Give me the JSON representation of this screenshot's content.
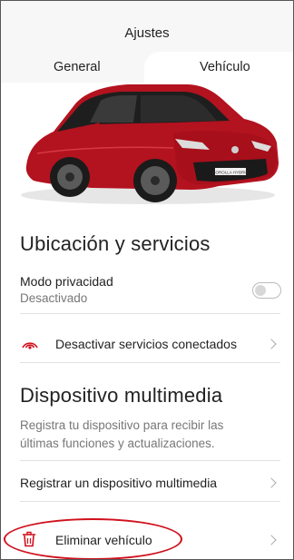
{
  "header": {
    "title": "Ajustes"
  },
  "tabs": [
    {
      "label": "General",
      "active": false
    },
    {
      "label": "Vehículo",
      "active": true
    }
  ],
  "vehicle": {
    "plate_text": "COROLLA HYBRID",
    "body_color": "#b3121f"
  },
  "location_section": {
    "title": "Ubicación y servicios",
    "privacy": {
      "label": "Modo privacidad",
      "status": "Desactivado",
      "enabled": false
    },
    "disconnect": {
      "label": "Desactivar servicios conectados",
      "icon": "signal-waves-icon"
    }
  },
  "multimedia_section": {
    "title": "Dispositivo multimedia",
    "description": "Registra tu dispositivo para recibir las últimas funciones y actualizaciones.",
    "register": {
      "label": "Registrar un dispositivo multimedia"
    }
  },
  "delete_vehicle": {
    "label": "Eliminar vehículo",
    "icon": "trash-icon"
  },
  "colors": {
    "accent_red": "#d0101c",
    "secondary_text": "#777777",
    "divider": "#e2e2e2"
  }
}
